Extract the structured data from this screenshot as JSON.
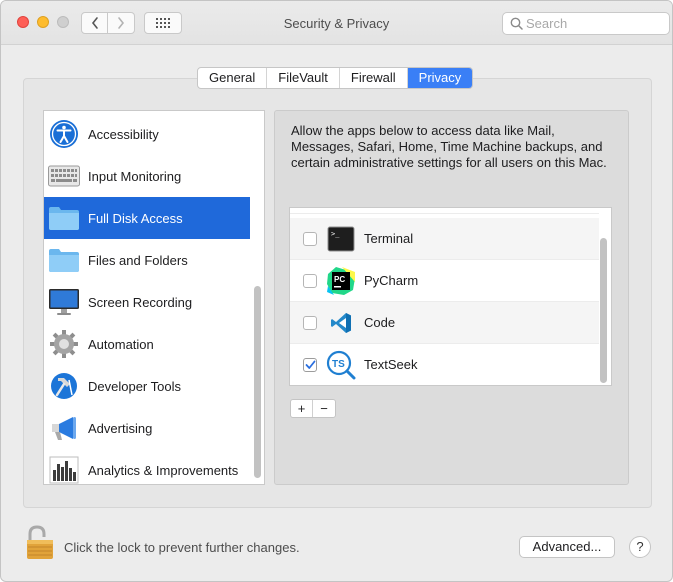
{
  "window": {
    "title": "Security & Privacy"
  },
  "search": {
    "placeholder": "Search"
  },
  "tabs": [
    {
      "label": "General",
      "active": false
    },
    {
      "label": "FileVault",
      "active": false
    },
    {
      "label": "Firewall",
      "active": false
    },
    {
      "label": "Privacy",
      "active": true
    }
  ],
  "sidebar": {
    "items": [
      {
        "label": "Accessibility",
        "icon": "accessibility-icon"
      },
      {
        "label": "Input Monitoring",
        "icon": "keyboard-icon"
      },
      {
        "label": "Full Disk Access",
        "icon": "folder-icon",
        "selected": true
      },
      {
        "label": "Files and Folders",
        "icon": "folder-icon"
      },
      {
        "label": "Screen Recording",
        "icon": "display-icon"
      },
      {
        "label": "Automation",
        "icon": "gear-icon"
      },
      {
        "label": "Developer Tools",
        "icon": "hammer-icon"
      },
      {
        "label": "Advertising",
        "icon": "megaphone-icon"
      },
      {
        "label": "Analytics & Improvements",
        "icon": "bar-chart-icon"
      }
    ]
  },
  "main": {
    "description": "Allow the apps below to access data like Mail, Messages, Safari, Home, Time Machine backups, and certain administrative settings for all users on this Mac.",
    "apps": [
      {
        "name": "Terminal",
        "checked": false,
        "icon": "terminal-icon"
      },
      {
        "name": "PyCharm",
        "checked": false,
        "icon": "pycharm-icon"
      },
      {
        "name": "Code",
        "checked": false,
        "icon": "vscode-icon"
      },
      {
        "name": "TextSeek",
        "checked": true,
        "icon": "textseek-icon"
      }
    ],
    "add_label": "+",
    "remove_label": "−"
  },
  "footer": {
    "lock_text": "Click the lock to prevent further changes.",
    "advanced_label": "Advanced...",
    "help_label": "?"
  },
  "colors": {
    "accent": "#3a7ff6",
    "selection": "#1f69da",
    "close": "#fe5f57",
    "minimize": "#febc2e"
  }
}
